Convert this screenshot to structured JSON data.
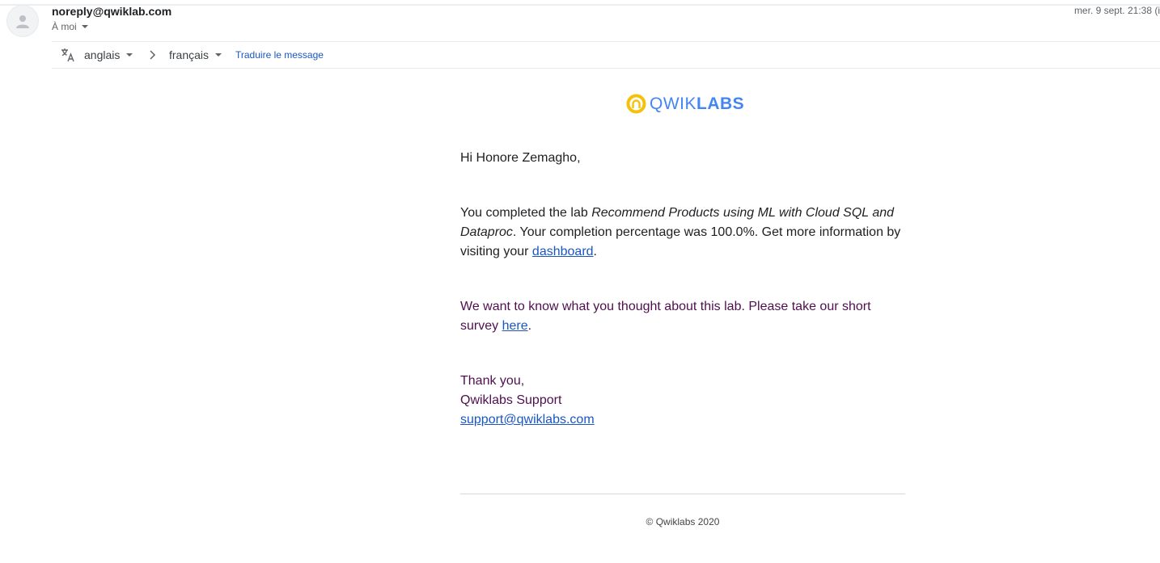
{
  "header": {
    "sender": "noreply@qwiklab.com",
    "recipient": "À moi",
    "date": "mer. 9 sept. 21:38 (i"
  },
  "translation_bar": {
    "source_language": "anglais",
    "target_language": "français",
    "translate_link": "Traduire le message"
  },
  "email": {
    "logo": {
      "light": "QWIK",
      "bold": "LABS"
    },
    "greeting": "Hi Honore Zemagho,",
    "completed_prefix": "You completed the lab ",
    "lab_name": "Recommend Products using ML with Cloud SQL and Dataproc",
    "completed_suffix": ". Your completion percentage was 100.0%. Get more information by visiting your ",
    "dashboard_link": "dashboard",
    "period": ".",
    "survey_prefix": "We want to know what you thought about this lab. Please take our short survey ",
    "survey_link": "here",
    "thanks": "Thank you,",
    "team": "Qwiklabs Support",
    "support_email": "support@qwiklabs.com",
    "footer": "© Qwiklabs 2020"
  },
  "colors": {
    "link": "#1a56c3",
    "logo_blue": "#4485f4",
    "logo_yellow": "#f4c20d",
    "visited_text": "#4f0f4f"
  }
}
